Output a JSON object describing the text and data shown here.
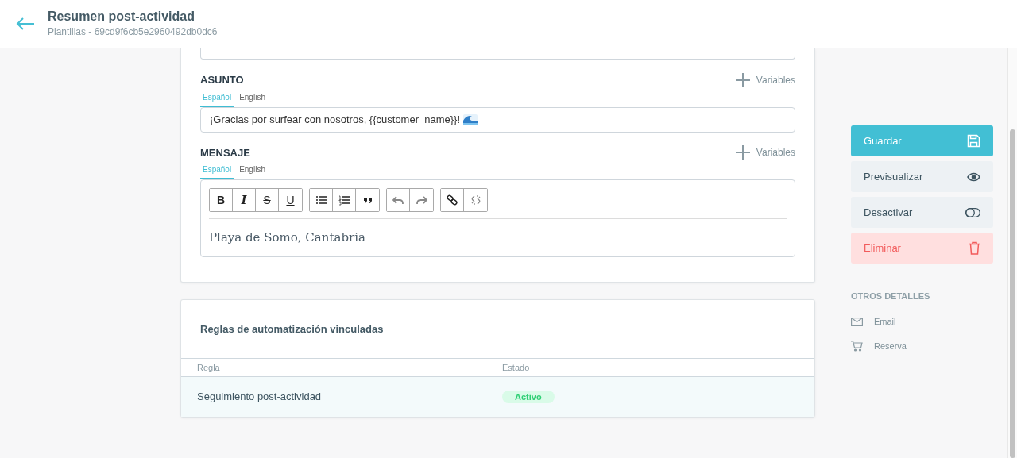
{
  "header": {
    "title": "Resumen post-actividad",
    "subtitle": "Plantillas - 69cd9f6cb5e2960492db0dc6"
  },
  "subject": {
    "label": "ASUNTO",
    "variables_label": "Variables",
    "tabs": [
      {
        "label": "Español",
        "selected": true
      },
      {
        "label": "English",
        "selected": false
      }
    ],
    "value": "¡Gracias por surfear con nosotros, {{customer_name}}!"
  },
  "message": {
    "label": "MENSAJE",
    "variables_label": "Variables",
    "tabs": [
      {
        "label": "Español",
        "selected": true
      },
      {
        "label": "English",
        "selected": false
      }
    ],
    "toolbar": [
      [
        {
          "kind": "bold",
          "label": "B",
          "disabled": false
        },
        {
          "kind": "italic",
          "label": "I",
          "disabled": false
        },
        {
          "kind": "strike",
          "label": "S",
          "disabled": false
        },
        {
          "kind": "underline",
          "label": "U",
          "disabled": false
        }
      ],
      [
        {
          "kind": "bullet-list",
          "disabled": false
        },
        {
          "kind": "ordered-list",
          "disabled": false
        },
        {
          "kind": "quote",
          "disabled": false
        }
      ],
      [
        {
          "kind": "undo",
          "disabled": true
        },
        {
          "kind": "redo",
          "disabled": true
        }
      ],
      [
        {
          "kind": "link",
          "disabled": false
        },
        {
          "kind": "unlink",
          "disabled": true
        }
      ]
    ],
    "body": "Playa de Somo, Cantabria"
  },
  "rules": {
    "title": "Reglas de automatización vinculadas",
    "columns": [
      "Regla",
      "Estado"
    ],
    "rows": [
      {
        "rule": "Seguimiento post-actividad",
        "status": "Activo",
        "active": true
      }
    ]
  },
  "actions": [
    {
      "kind": "save",
      "label": "Guardar"
    },
    {
      "kind": "preview",
      "label": "Previsualizar"
    },
    {
      "kind": "deactivate",
      "label": "Desactivar"
    },
    {
      "kind": "delete",
      "label": "Eliminar"
    }
  ],
  "details": {
    "title": "OTROS DETALLES",
    "items": [
      {
        "kind": "email",
        "label": "Email"
      },
      {
        "kind": "booking",
        "label": "Reserva"
      }
    ]
  }
}
